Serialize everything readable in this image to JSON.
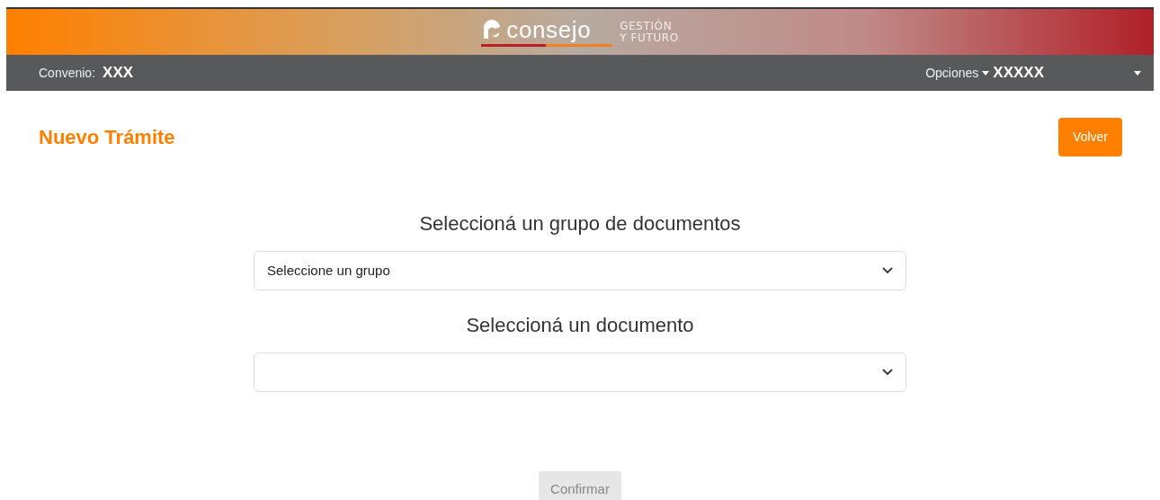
{
  "header": {
    "logo_word": "consejo",
    "tagline_1": "GESTIÓN",
    "tagline_2": "Y FUTURO"
  },
  "navbar": {
    "convenio_label": "Convenio:",
    "convenio_value": "XXX",
    "options_menu": "Opciones",
    "user": "XXXXX"
  },
  "page": {
    "title": "Nuevo Trámite",
    "back_button": "Volver"
  },
  "fields": [
    {
      "label": "Seleccioná un grupo de documentos",
      "value": "Seleccione un grupo"
    },
    {
      "label": "Seleccioná un documento"
    }
  ],
  "confirm_button": {
    "label": "Confirmar",
    "disabled": true
  }
}
